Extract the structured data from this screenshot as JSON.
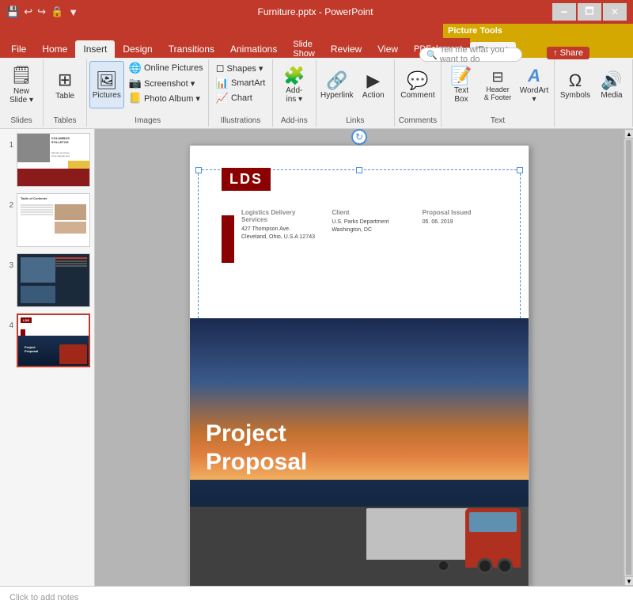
{
  "titlebar": {
    "left_icons": [
      "💾",
      "↩",
      "↪",
      "🔒",
      "▼"
    ],
    "title": "Furniture.pptx - PowerPoint",
    "context_tool": "Picture Tools",
    "min": "🗕",
    "max": "🗖",
    "close": "✕"
  },
  "tabs": {
    "normal": [
      "File",
      "Home",
      "Insert",
      "Design",
      "Transitions",
      "Animations",
      "Slide Show",
      "Review",
      "View",
      "PDFelement"
    ],
    "active": "Insert",
    "context": "Format"
  },
  "ribbon": {
    "groups": [
      {
        "name": "Slides",
        "buttons": [
          {
            "label": "New\nSlide",
            "icon": "🗒",
            "type": "large"
          }
        ]
      },
      {
        "name": "Tables",
        "buttons": [
          {
            "label": "Table",
            "icon": "⊞",
            "type": "large"
          }
        ]
      },
      {
        "name": "Images",
        "buttons": [
          {
            "label": "Pictures",
            "icon": "🖼",
            "type": "large",
            "active": true
          },
          {
            "label": "Online Pictures",
            "icon": "🌐",
            "type": "small"
          },
          {
            "label": "Screenshot ▾",
            "icon": "📷",
            "type": "small"
          },
          {
            "label": "Photo Album ▾",
            "icon": "📒",
            "type": "small"
          }
        ]
      },
      {
        "name": "Illustrations",
        "buttons": [
          {
            "label": "Shapes ▾",
            "icon": "◻",
            "type": "small"
          },
          {
            "label": "SmartArt",
            "icon": "📊",
            "type": "small"
          },
          {
            "label": "Chart",
            "icon": "📈",
            "type": "small"
          }
        ]
      },
      {
        "name": "Add-ins",
        "buttons": [
          {
            "label": "Add-\nins ▾",
            "icon": "🧩",
            "type": "large"
          }
        ]
      },
      {
        "name": "Links",
        "buttons": [
          {
            "label": "Hyperlink",
            "icon": "🔗",
            "type": "large"
          },
          {
            "label": "Action",
            "icon": "▶",
            "type": "large"
          }
        ]
      },
      {
        "name": "Comments",
        "buttons": [
          {
            "label": "Comment",
            "icon": "💬",
            "type": "large"
          }
        ]
      },
      {
        "name": "Text",
        "buttons": [
          {
            "label": "Text\nBox",
            "icon": "📝",
            "type": "large"
          },
          {
            "label": "Header\n& Footer",
            "icon": "⊟",
            "type": "large"
          },
          {
            "label": "WordArt ▾",
            "icon": "A",
            "type": "large"
          }
        ]
      },
      {
        "name": "",
        "buttons": [
          {
            "label": "Symbols",
            "icon": "Ω",
            "type": "large"
          },
          {
            "label": "Media",
            "icon": "🔊",
            "type": "large"
          }
        ]
      }
    ]
  },
  "slides": [
    {
      "num": "1",
      "selected": false
    },
    {
      "num": "2",
      "selected": false
    },
    {
      "num": "3",
      "selected": false
    },
    {
      "num": "4",
      "selected": true
    }
  ],
  "current_slide": {
    "logo": "LDS",
    "logistics_label": "Logistics Delivery Services",
    "client_label": "Client",
    "proposal_label": "Proposal Issued",
    "address": "427 Thompson Ave.\nCleveland, Ohio, U.S.A 12743",
    "client_value": "U.S. Parks Department\nWashington, DC",
    "date_value": "05. 06. 2019",
    "proposal_text": "Project\nProposal"
  },
  "tell_me": {
    "placeholder": "Tell me what you want to do"
  },
  "notes": {
    "placeholder": "Click to add notes"
  },
  "picture_tools_label": "Picture Tools",
  "format_tab_label": "Format",
  "text_label": "Text"
}
